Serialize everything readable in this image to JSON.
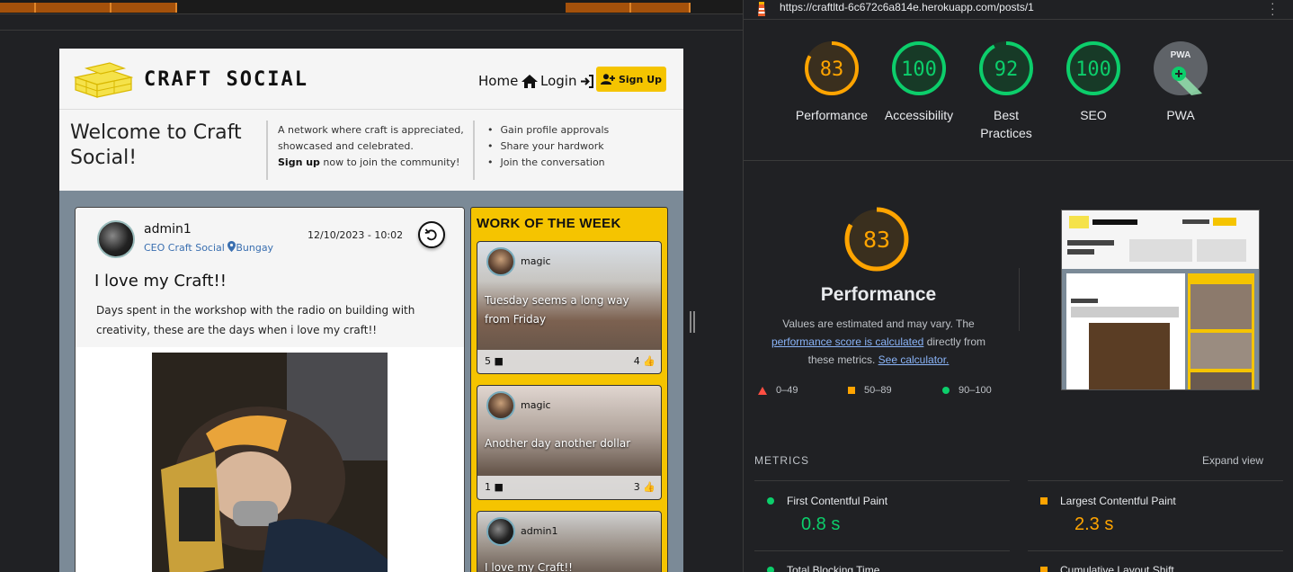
{
  "site": {
    "brand": "CRAFT SOCIAL",
    "nav": {
      "home": "Home",
      "login": "Login",
      "signup": "Sign Up"
    },
    "hero": {
      "title": "Welcome to Craft Social!",
      "text_line1": "A network where craft is appreciated, showcased and celebrated.",
      "text_signup": "Sign up",
      "text_rest": " now to join the community!",
      "list": [
        "Gain profile approvals",
        "Share your hardwork",
        "Join the conversation"
      ]
    },
    "post": {
      "author": "admin1",
      "role": "CEO Craft Social",
      "location": "Bungay",
      "date": "12/10/2023 - 10:02",
      "title": "I love my Craft!!",
      "body": "Days spent in the workshop with the radio on building with creativity, these are the days when i love my craft!!"
    },
    "work_of_week": {
      "title": "WORK OF THE WEEK",
      "cards": [
        {
          "user": "magic",
          "text": "Tuesday seems a long way from Friday",
          "comments": "5",
          "likes": "4"
        },
        {
          "user": "magic",
          "text": "Another day another dollar",
          "comments": "1",
          "likes": "3"
        },
        {
          "user": "admin1",
          "text": "I love my Craft!!",
          "comments": "",
          "likes": ""
        }
      ]
    }
  },
  "lighthouse": {
    "url": "https://craftltd-6c672c6a814e.herokuapp.com/posts/1",
    "scores": [
      {
        "label": "Performance",
        "score": "83",
        "value": 83,
        "color": "#ffa400"
      },
      {
        "label": "Accessibility",
        "score": "100",
        "value": 100,
        "color": "#0cce6b"
      },
      {
        "label": "Best Practices",
        "score": "92",
        "value": 92,
        "color": "#0cce6b"
      },
      {
        "label": "SEO",
        "score": "100",
        "value": 100,
        "color": "#0cce6b"
      },
      {
        "label": "PWA",
        "score": "",
        "value": 0,
        "color": "#888888"
      }
    ],
    "perf_score": "83",
    "perf_title": "Performance",
    "desc_1": "Values are estimated and may vary. The ",
    "desc_link1": "performance score is calculated",
    "desc_2": " directly from these metrics. ",
    "desc_link2": "See calculator.",
    "legend": {
      "poor": "0–49",
      "avg": "50–89",
      "good": "90–100"
    },
    "metrics_title": "METRICS",
    "expand": "Expand view",
    "metrics": [
      {
        "name": "First Contentful Paint",
        "value": "0.8 s",
        "status": "good"
      },
      {
        "name": "Largest Contentful Paint",
        "value": "2.3 s",
        "status": "average"
      },
      {
        "name": "Total Blocking Time",
        "value": "",
        "status": "good"
      },
      {
        "name": "Cumulative Layout Shift",
        "value": "",
        "status": "average"
      }
    ]
  },
  "colors": {
    "accent_yellow": "#f5c400",
    "good": "#0cce6b",
    "average": "#ffa400",
    "poor": "#ff4e42",
    "link": "#8ab4f8"
  }
}
